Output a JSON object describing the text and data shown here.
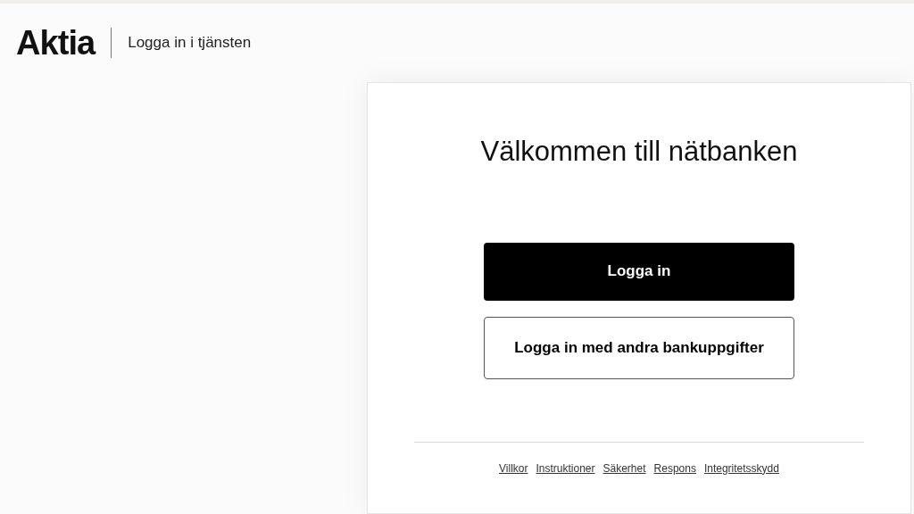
{
  "header": {
    "logo": "Aktia",
    "title": "Logga in i tjänsten"
  },
  "card": {
    "heading": "Välkommen till nätbanken",
    "buttons": [
      {
        "label": "Logga in",
        "kind": "primary"
      },
      {
        "label": "Logga in med andra bankuppgifter",
        "kind": "secondary"
      }
    ],
    "footer_links": [
      "Villkor",
      "Instruktioner",
      "Säkerhet",
      "Respons",
      "Integritetsskydd"
    ]
  }
}
